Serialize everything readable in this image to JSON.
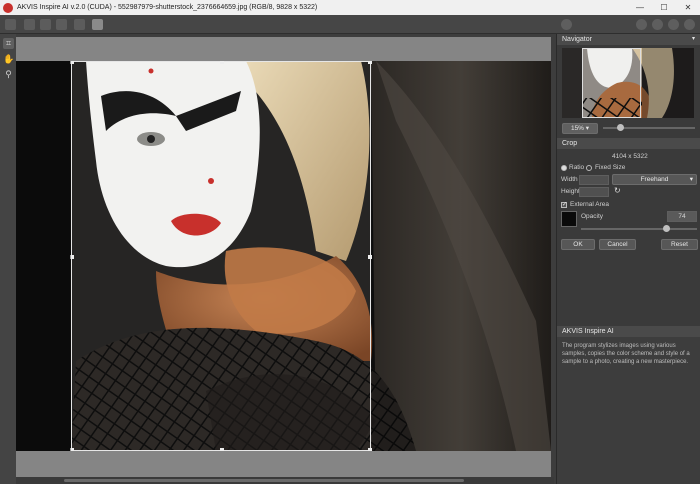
{
  "window": {
    "title": "AKVIS Inspire AI v.2.0 (CUDA) - 552987979-shutterstock_2376664659.jpg (RGB/8, 9828 x 5322)",
    "minimize_glyph": "—",
    "maximize_glyph": "☐",
    "close_glyph": "✕"
  },
  "navigator": {
    "header": "Navigator",
    "zoom_value": "15%"
  },
  "crop": {
    "header": "Crop",
    "size": "4104 x 5322",
    "ratio_label": "Ratio",
    "fixed_size_label": "Fixed Size",
    "width_label": "Width",
    "height_label": "Height",
    "mode_value": "Freehand",
    "external_area_label": "External Area",
    "external_area_checked": true,
    "opacity_label": "Opacity",
    "opacity_value": "74",
    "opacity_level": 0.74,
    "ok_label": "OK",
    "cancel_label": "Cancel",
    "reset_label": "Reset"
  },
  "info": {
    "header": "AKVIS Inspire AI",
    "text": "The program stylizes images using various samples, copies the color scheme and style of a sample to a photo, creating a new masterpiece."
  },
  "colors": {
    "accent": "#c8302c",
    "panel_bg": "#3a3a3a"
  }
}
